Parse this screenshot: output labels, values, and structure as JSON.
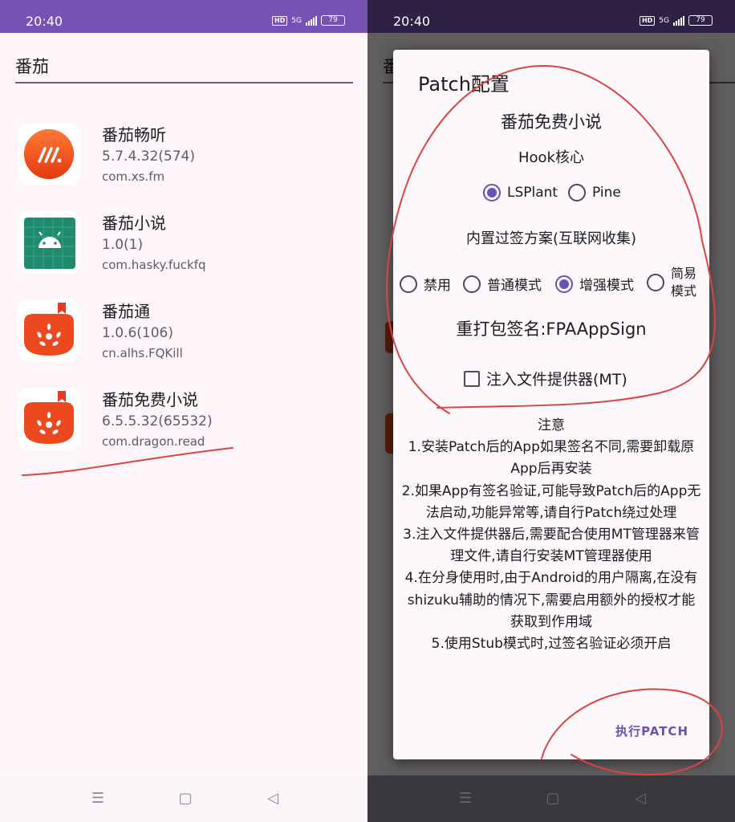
{
  "status_bar": {
    "time": "20:40",
    "hd_label": "HD",
    "net_label": "5G",
    "battery": "79",
    "icons": [
      "hd-icon",
      "signal-icon",
      "battery-icon"
    ]
  },
  "search": {
    "value": "番茄"
  },
  "apps": [
    {
      "name": "番茄畅听",
      "version": "5.7.4.32(574)",
      "package": "com.xs.fm",
      "icon": "fanqie-tingting-icon"
    },
    {
      "name": "番茄小说",
      "version": "1.0(1)",
      "package": "com.hasky.fuckfq",
      "icon": "android-icon"
    },
    {
      "name": "番茄通",
      "version": "1.0.6(106)",
      "package": "cn.alhs.FQKill",
      "icon": "tomato-icon"
    },
    {
      "name": "番茄免费小说",
      "version": "6.5.5.32(65532)",
      "package": "com.dragon.read",
      "icon": "tomato-icon"
    }
  ],
  "dialog": {
    "title": "Patch配置",
    "app_name": "番茄免费小说",
    "hook_label": "Hook核心",
    "hook_options": [
      {
        "label": "LSPlant",
        "selected": true
      },
      {
        "label": "Pine",
        "selected": false
      }
    ],
    "sig_label": "内置过签方案(互联网收集)",
    "sig_options": [
      {
        "label": "禁用",
        "selected": false
      },
      {
        "label": "普通模式",
        "selected": false
      },
      {
        "label": "增强模式",
        "selected": true
      },
      {
        "label": "简易\n模式",
        "selected": false
      }
    ],
    "resign_label": "重打包签名:FPAAppSign",
    "inject_label": "注入文件提供器(MT)",
    "inject_checked": false,
    "notes_title": "注意",
    "notes": [
      "1.安装Patch后的App如果签名不同,需要卸载原App后再安装",
      "2.如果App有签名验证,可能导致Patch后的App无法启动,功能异常等,请自行Patch绕过处理",
      "3.注入文件提供器后,需要配合使用MT管理器来管理文件,请自行安装MT管理器使用",
      "4.在分身使用时,由于Android的用户隔离,在没有shizuku辅助的情况下,需要启用额外的授权才能获取到作用域",
      "5.使用Stub模式时,过签名验证必须开启"
    ],
    "patch_button": "执行PATCH"
  },
  "bg_partial_text": "番",
  "colors": {
    "accent": "#6c4fb8",
    "status_bar_left": "#7752b2",
    "status_bar_right": "#2f2145",
    "annotation_ink": "#d9453e"
  }
}
